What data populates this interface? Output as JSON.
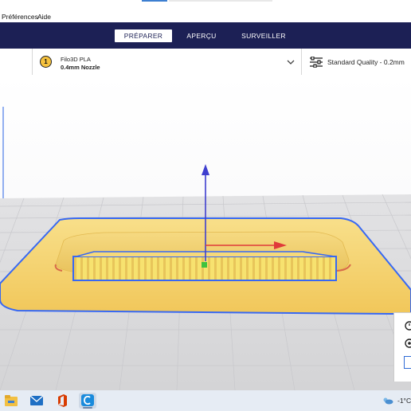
{
  "menubar": {
    "prefs": "Préférences",
    "help": "Aide"
  },
  "stages": {
    "prepare": "PRÉPARER",
    "preview": "APERÇU",
    "monitor": "SURVEILLER"
  },
  "material": {
    "badge": "1",
    "name": "Filo3D PLA",
    "nozzle": "0.4mm Nozzle"
  },
  "quality": {
    "label": "Standard Quality - 0.2mm"
  },
  "taskbar": {
    "temperature": "-1°C"
  },
  "icons": {
    "stage_chevron": "chevron-down-icon",
    "quality": "sliders-icon",
    "apps": [
      "file-explorer-icon",
      "mail-icon",
      "office-icon",
      "cura-icon"
    ],
    "tray": [
      "weather-icon"
    ]
  },
  "colors": {
    "stage_bar": "#1c2055",
    "model_fill": "#f6d372",
    "selection_outline": "#3768f3",
    "axis_x": "#e03a3a",
    "axis_y": "#3f3fcf",
    "axis_z": "#3fc23f",
    "taskbar": "#e6ecf4"
  }
}
